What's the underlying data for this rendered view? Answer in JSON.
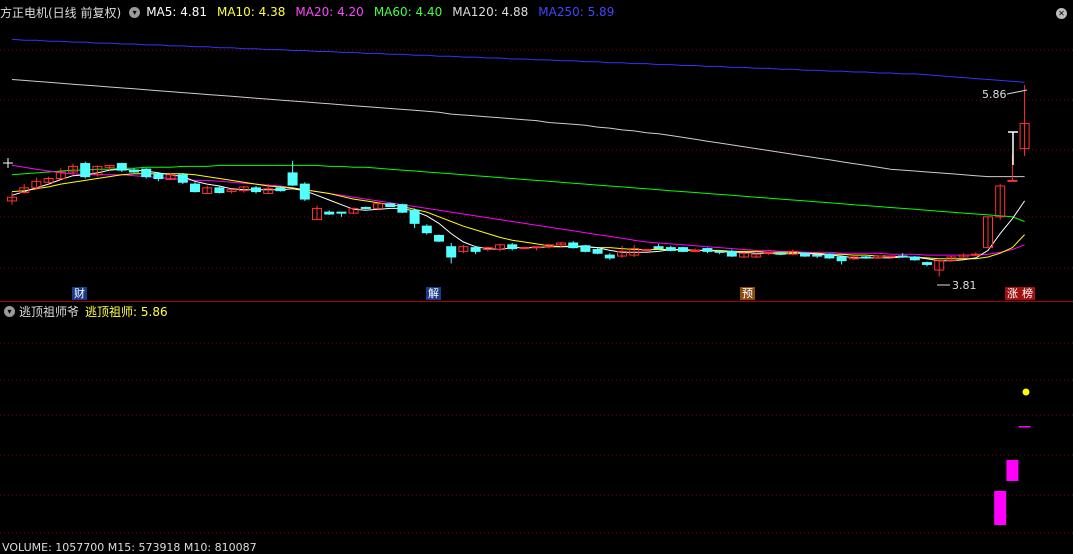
{
  "header": {
    "title": "方正电机(日线 前复权)",
    "ma": [
      {
        "label": "MA5: 4.81",
        "color": "#ffffff"
      },
      {
        "label": "MA10: 4.38",
        "color": "#ffff44"
      },
      {
        "label": "MA20: 4.20",
        "color": "#ff44ff"
      },
      {
        "label": "MA60: 4.40",
        "color": "#44ff44"
      },
      {
        "label": "MA120: 4.88",
        "color": "#dddddd"
      },
      {
        "label": "MA250: 5.89",
        "color": "#4444ff"
      }
    ]
  },
  "price_panel": {
    "high_label": "5.86",
    "low_label": "3.81",
    "markers": [
      {
        "text": "财",
        "color": "#ffffff",
        "bg": "#1a3a8a"
      },
      {
        "text": "解",
        "color": "#ffffff",
        "bg": "#1a3a8a"
      },
      {
        "text": "预",
        "color": "#ffffff",
        "bg": "#8a4a10"
      },
      {
        "text": "涨",
        "color": "#ffffff",
        "bg": "#a01010"
      },
      {
        "text": "榜",
        "color": "#ffffff",
        "bg": "#a01010"
      }
    ]
  },
  "indicator_panel": {
    "name": "逃顶祖师爷",
    "value_label": "逃顶祖师: 5.86"
  },
  "volume_panel": {
    "label": "VOLUME: 1057700  M15: 573918  M10: 810087"
  },
  "colors": {
    "up": "#ff3232",
    "down": "#54ffff",
    "ma5": "#ffffff",
    "ma10": "#ffff00",
    "ma20": "#ff00ff",
    "ma60": "#00ff00",
    "ma120": "#cccccc",
    "ma250": "#3333ff",
    "grid": "#8b0000",
    "histo": "#ff00ff",
    "dot": "#ffff00"
  },
  "chart_data": {
    "type": "candlestick",
    "candles": [
      [
        4.62,
        4.66,
        4.71,
        4.58
      ],
      [
        4.71,
        4.76,
        4.8,
        4.7
      ],
      [
        4.76,
        4.83,
        4.87,
        4.74
      ],
      [
        4.82,
        4.86,
        4.88,
        4.8
      ],
      [
        4.86,
        4.93,
        4.97,
        4.85
      ],
      [
        4.93,
        4.99,
        5.02,
        4.9
      ],
      [
        5.02,
        4.88,
        5.04,
        4.86
      ],
      [
        4.9,
        4.99,
        5.0,
        4.88
      ],
      [
        4.98,
        5.0,
        5.0,
        4.95
      ],
      [
        5.02,
        4.95,
        5.03,
        4.93
      ],
      [
        4.95,
        4.93,
        4.97,
        4.92
      ],
      [
        4.96,
        4.88,
        4.97,
        4.86
      ],
      [
        4.91,
        4.86,
        4.93,
        4.83
      ],
      [
        4.85,
        4.9,
        4.92,
        4.85
      ],
      [
        4.9,
        4.82,
        4.92,
        4.8
      ],
      [
        4.8,
        4.72,
        4.82,
        4.71
      ],
      [
        4.7,
        4.76,
        4.78,
        4.7
      ],
      [
        4.76,
        4.71,
        4.78,
        4.7
      ],
      [
        4.72,
        4.74,
        4.75,
        4.7
      ],
      [
        4.73,
        4.77,
        4.78,
        4.71
      ],
      [
        4.76,
        4.72,
        4.78,
        4.7
      ],
      [
        4.7,
        4.75,
        4.8,
        4.7
      ],
      [
        4.76,
        4.73,
        4.78,
        4.72
      ],
      [
        4.92,
        4.79,
        5.05,
        4.78
      ],
      [
        4.8,
        4.64,
        4.82,
        4.62
      ],
      [
        4.42,
        4.54,
        4.57,
        4.42
      ],
      [
        4.5,
        4.48,
        4.52,
        4.47
      ],
      [
        4.5,
        4.49,
        4.5,
        4.45
      ],
      [
        4.49,
        4.54,
        4.55,
        4.48
      ],
      [
        4.55,
        4.54,
        4.56,
        4.53
      ],
      [
        4.54,
        4.59,
        4.61,
        4.53
      ],
      [
        4.59,
        4.56,
        4.6,
        4.56
      ],
      [
        4.58,
        4.5,
        4.59,
        4.49
      ],
      [
        4.52,
        4.38,
        4.54,
        4.33
      ],
      [
        4.35,
        4.28,
        4.37,
        4.26
      ],
      [
        4.25,
        4.19,
        4.26,
        4.18
      ],
      [
        4.13,
        4.02,
        4.17,
        3.95
      ],
      [
        4.08,
        4.13,
        4.15,
        4.06
      ],
      [
        4.12,
        4.08,
        4.14,
        4.05
      ],
      [
        4.1,
        4.12,
        4.13,
        4.08
      ],
      [
        4.1,
        4.15,
        4.16,
        4.08
      ],
      [
        4.15,
        4.11,
        4.17,
        4.09
      ],
      [
        4.12,
        4.12,
        4.13,
        4.1
      ],
      [
        4.12,
        4.13,
        4.13,
        4.09
      ],
      [
        4.13,
        4.15,
        4.16,
        4.11
      ],
      [
        4.15,
        4.17,
        4.18,
        4.12
      ],
      [
        4.17,
        4.12,
        4.19,
        4.11
      ],
      [
        4.14,
        4.08,
        4.15,
        4.07
      ],
      [
        4.1,
        4.06,
        4.12,
        4.05
      ],
      [
        4.04,
        4.01,
        4.06,
        3.99
      ],
      [
        4.03,
        4.08,
        4.14,
        4.01
      ],
      [
        4.04,
        4.11,
        4.15,
        4.02
      ],
      [
        4.1,
        4.1,
        4.1,
        4.08
      ],
      [
        4.13,
        4.11,
        4.16,
        4.1
      ],
      [
        4.12,
        4.09,
        4.14,
        4.08
      ],
      [
        4.12,
        4.08,
        4.13,
        4.07
      ],
      [
        4.09,
        4.09,
        4.11,
        4.07
      ],
      [
        4.11,
        4.08,
        4.12,
        4.06
      ],
      [
        4.08,
        4.07,
        4.09,
        4.05
      ],
      [
        4.08,
        4.03,
        4.1,
        4.02
      ],
      [
        4.02,
        4.06,
        4.07,
        4.01
      ],
      [
        4.02,
        4.05,
        4.06,
        4.01
      ],
      [
        4.06,
        4.07,
        4.08,
        4.04
      ],
      [
        4.06,
        4.05,
        4.06,
        4.04
      ],
      [
        4.05,
        4.08,
        4.1,
        4.04
      ],
      [
        4.06,
        4.03,
        4.07,
        4.02
      ],
      [
        4.04,
        4.03,
        4.05,
        4.01
      ],
      [
        4.05,
        4.01,
        4.06,
        4.0
      ],
      [
        4.02,
        3.98,
        4.03,
        3.94
      ],
      [
        4.0,
        4.02,
        4.04,
        3.99
      ],
      [
        4.02,
        4.01,
        4.03,
        4.0
      ],
      [
        4.01,
        4.03,
        4.04,
        4.0
      ],
      [
        4.02,
        4.03,
        4.03,
        4.01
      ],
      [
        4.03,
        4.02,
        4.06,
        4.01
      ],
      [
        4.02,
        3.99,
        4.03,
        3.98
      ],
      [
        3.96,
        3.94,
        3.97,
        3.92
      ],
      [
        3.88,
        3.98,
        3.99,
        3.81
      ],
      [
        3.98,
        4.02,
        4.03,
        3.97
      ],
      [
        4.02,
        4.04,
        4.06,
        4.01
      ],
      [
        4.04,
        4.05,
        4.07,
        4.03
      ],
      [
        4.12,
        4.45,
        4.45,
        4.12
      ],
      [
        4.45,
        4.78,
        4.8,
        4.42
      ],
      [
        4.84,
        4.84,
        5.12,
        4.84
      ],
      [
        5.18,
        5.45,
        5.86,
        5.1
      ]
    ],
    "ma5": [
      4.68,
      4.72,
      4.76,
      4.8,
      4.85,
      4.89,
      4.9,
      4.92,
      4.95,
      4.96,
      4.95,
      4.94,
      4.92,
      4.9,
      4.88,
      4.83,
      4.8,
      4.78,
      4.75,
      4.74,
      4.74,
      4.74,
      4.74,
      4.75,
      4.73,
      4.68,
      4.63,
      4.58,
      4.53,
      4.52,
      4.53,
      4.54,
      4.54,
      4.51,
      4.46,
      4.38,
      4.27,
      4.18,
      4.13,
      4.11,
      4.1,
      4.12,
      4.12,
      4.12,
      4.13,
      4.13,
      4.14,
      4.13,
      4.12,
      4.09,
      4.07,
      4.07,
      4.07,
      4.08,
      4.1,
      4.1,
      4.09,
      4.09,
      4.08,
      4.07,
      4.07,
      4.06,
      4.06,
      4.05,
      4.06,
      4.06,
      4.05,
      4.04,
      4.03,
      4.01,
      4.01,
      4.01,
      4.01,
      4.02,
      4.02,
      4.0,
      3.98,
      3.98,
      3.99,
      4.01,
      4.09,
      4.27,
      4.43,
      4.62
    ],
    "ma10": [
      4.72,
      4.73,
      4.75,
      4.77,
      4.8,
      4.82,
      4.84,
      4.86,
      4.88,
      4.9,
      4.91,
      4.91,
      4.91,
      4.91,
      4.91,
      4.9,
      4.88,
      4.86,
      4.84,
      4.82,
      4.8,
      4.78,
      4.77,
      4.76,
      4.74,
      4.72,
      4.7,
      4.67,
      4.64,
      4.62,
      4.6,
      4.58,
      4.56,
      4.53,
      4.5,
      4.45,
      4.4,
      4.35,
      4.31,
      4.27,
      4.23,
      4.2,
      4.18,
      4.16,
      4.14,
      4.13,
      4.13,
      4.13,
      4.12,
      4.12,
      4.11,
      4.1,
      4.1,
      4.1,
      4.1,
      4.09,
      4.09,
      4.09,
      4.09,
      4.08,
      4.08,
      4.08,
      4.07,
      4.07,
      4.07,
      4.06,
      4.06,
      4.05,
      4.05,
      4.04,
      4.04,
      4.03,
      4.03,
      4.02,
      4.02,
      4.01,
      4.0,
      4.0,
      4.0,
      4.0,
      4.02,
      4.06,
      4.12,
      4.26
    ],
    "ma20": [
      5.0,
      4.98,
      4.96,
      4.94,
      4.92,
      4.91,
      4.9,
      4.9,
      4.9,
      4.9,
      4.89,
      4.88,
      4.87,
      4.86,
      4.85,
      4.84,
      4.84,
      4.83,
      4.82,
      4.81,
      4.8,
      4.79,
      4.78,
      4.76,
      4.74,
      4.72,
      4.7,
      4.68,
      4.66,
      4.64,
      4.62,
      4.6,
      4.58,
      4.56,
      4.54,
      4.52,
      4.5,
      4.48,
      4.46,
      4.44,
      4.42,
      4.4,
      4.38,
      4.36,
      4.34,
      4.32,
      4.3,
      4.28,
      4.26,
      4.24,
      4.22,
      4.2,
      4.18,
      4.17,
      4.16,
      4.15,
      4.14,
      4.13,
      4.12,
      4.11,
      4.1,
      4.09,
      4.09,
      4.08,
      4.08,
      4.07,
      4.07,
      4.07,
      4.06,
      4.06,
      4.06,
      4.06,
      4.05,
      4.05,
      4.05,
      4.04,
      4.04,
      4.04,
      4.04,
      4.04,
      4.05,
      4.07,
      4.1,
      4.15
    ],
    "ma60": [
      4.9,
      4.91,
      4.92,
      4.93,
      4.94,
      4.95,
      4.95,
      4.96,
      4.96,
      4.97,
      4.97,
      4.98,
      4.98,
      4.98,
      4.99,
      4.99,
      4.99,
      5.0,
      5.0,
      5.0,
      5.0,
      5.0,
      5.0,
      5.0,
      5.0,
      5.0,
      4.99,
      4.99,
      4.98,
      4.98,
      4.97,
      4.96,
      4.95,
      4.94,
      4.93,
      4.92,
      4.91,
      4.9,
      4.89,
      4.88,
      4.87,
      4.86,
      4.85,
      4.84,
      4.83,
      4.82,
      4.81,
      4.8,
      4.79,
      4.78,
      4.77,
      4.76,
      4.75,
      4.74,
      4.73,
      4.72,
      4.71,
      4.7,
      4.69,
      4.68,
      4.67,
      4.66,
      4.65,
      4.64,
      4.63,
      4.62,
      4.61,
      4.6,
      4.59,
      4.58,
      4.57,
      4.56,
      4.55,
      4.54,
      4.53,
      4.52,
      4.51,
      4.5,
      4.49,
      4.48,
      4.47,
      4.46,
      4.45,
      4.4
    ],
    "ma120": [
      5.92,
      5.91,
      5.9,
      5.89,
      5.88,
      5.87,
      5.86,
      5.85,
      5.84,
      5.83,
      5.82,
      5.81,
      5.8,
      5.79,
      5.78,
      5.77,
      5.76,
      5.75,
      5.74,
      5.73,
      5.72,
      5.71,
      5.7,
      5.69,
      5.68,
      5.67,
      5.66,
      5.65,
      5.64,
      5.63,
      5.62,
      5.61,
      5.6,
      5.59,
      5.58,
      5.57,
      5.55,
      5.54,
      5.53,
      5.52,
      5.51,
      5.5,
      5.49,
      5.48,
      5.46,
      5.45,
      5.44,
      5.43,
      5.41,
      5.4,
      5.38,
      5.37,
      5.35,
      5.34,
      5.32,
      5.3,
      5.28,
      5.26,
      5.24,
      5.22,
      5.2,
      5.18,
      5.16,
      5.14,
      5.12,
      5.1,
      5.08,
      5.06,
      5.04,
      5.02,
      5.0,
      4.98,
      4.96,
      4.95,
      4.94,
      4.93,
      4.92,
      4.91,
      4.9,
      4.89,
      4.88,
      4.88,
      4.88,
      4.88
    ],
    "ma250": [
      6.35,
      6.34,
      6.34,
      6.33,
      6.33,
      6.32,
      6.32,
      6.31,
      6.31,
      6.3,
      6.3,
      6.29,
      6.29,
      6.28,
      6.28,
      6.27,
      6.27,
      6.26,
      6.26,
      6.25,
      6.25,
      6.24,
      6.24,
      6.23,
      6.23,
      6.22,
      6.22,
      6.21,
      6.21,
      6.2,
      6.2,
      6.19,
      6.19,
      6.18,
      6.18,
      6.17,
      6.17,
      6.16,
      6.16,
      6.15,
      6.15,
      6.14,
      6.14,
      6.13,
      6.13,
      6.12,
      6.12,
      6.11,
      6.11,
      6.1,
      6.1,
      6.09,
      6.09,
      6.08,
      6.08,
      6.07,
      6.07,
      6.06,
      6.06,
      6.05,
      6.05,
      6.04,
      6.04,
      6.03,
      6.03,
      6.02,
      6.02,
      6.01,
      6.01,
      6.0,
      6.0,
      5.99,
      5.99,
      5.98,
      5.98,
      5.97,
      5.96,
      5.95,
      5.94,
      5.93,
      5.92,
      5.91,
      5.9,
      5.89
    ],
    "indicator": {
      "histogram": [
        0,
        0,
        0,
        0,
        0,
        0,
        0,
        0,
        0,
        0,
        0,
        0,
        0,
        0,
        0,
        0,
        0,
        0,
        0,
        0,
        0,
        0,
        0,
        0,
        0,
        0,
        0,
        0,
        0,
        0,
        0,
        0,
        0,
        0,
        0,
        0,
        0,
        0,
        0,
        0,
        0,
        0,
        0,
        0,
        0,
        0,
        0,
        0,
        0,
        0,
        0,
        0,
        0,
        0,
        0,
        0,
        0,
        0,
        0,
        0,
        0,
        0,
        0,
        0,
        0,
        0,
        0,
        0,
        0,
        0,
        0,
        0,
        0,
        0,
        0,
        0,
        0,
        0,
        0,
        0,
        0,
        4,
        2.8,
        0.4
      ],
      "dot_value": 5.86
    }
  }
}
